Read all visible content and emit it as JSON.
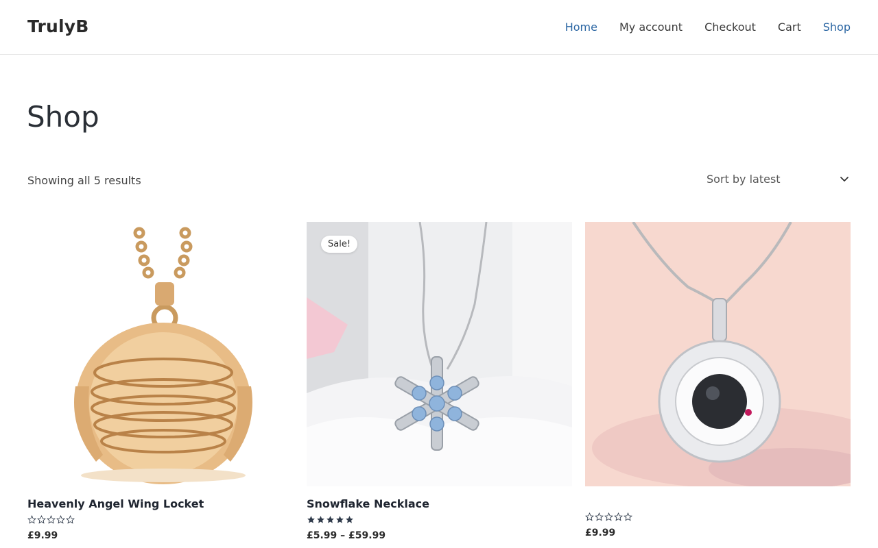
{
  "site": {
    "title": "TrulyB"
  },
  "nav": {
    "items": [
      {
        "label": "Home",
        "active": true
      },
      {
        "label": "My account",
        "active": false
      },
      {
        "label": "Checkout",
        "active": false
      },
      {
        "label": "Cart",
        "active": false
      },
      {
        "label": "Shop",
        "active": true
      }
    ]
  },
  "page": {
    "title": "Shop"
  },
  "toolbar": {
    "result_count": "Showing all 5 results",
    "sort_selected": "Sort by latest"
  },
  "products": [
    {
      "title": "Heavenly Angel Wing Locket",
      "price": "£9.99",
      "rating": 0,
      "rating_max": 5,
      "badge": "",
      "image": "gold-angel-wing-locket"
    },
    {
      "title": "Snowflake Necklace",
      "price": "£5.99 – £59.99",
      "rating": 5,
      "rating_max": 5,
      "badge": "Sale!",
      "image": "snowflake-pendant-necklace"
    },
    {
      "title": "",
      "price": "£9.99",
      "rating": 0,
      "rating_max": 5,
      "badge": "",
      "image": "projection-pendant-necklace"
    }
  ],
  "colors": {
    "accent": "#2b66a3",
    "text": "#3a3a3a",
    "heading": "#2a2f36",
    "star": "#2f3a4a"
  }
}
